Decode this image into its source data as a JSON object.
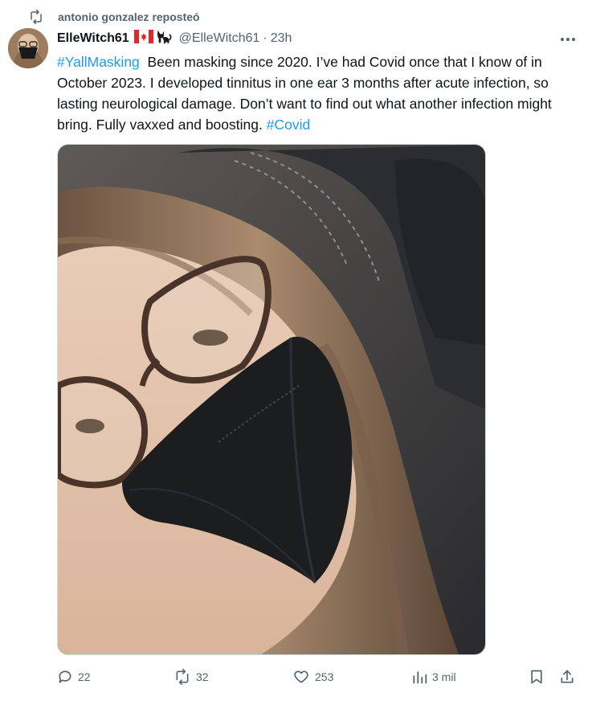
{
  "repost": {
    "icon": "repost-icon",
    "text": "antonio gonzalez reposteó"
  },
  "author": {
    "name": "ElleWitch61",
    "emoji": [
      "canada-flag-icon",
      "black-cat-icon"
    ],
    "handle": "@ElleWitch61",
    "separator": "·",
    "time": "23h"
  },
  "tweet": {
    "hashtag_1": "#YallMasking",
    "text_main": "Been masking since 2020. I’ve had Covid once that I know of in October 2023. I developed tinnitus in one ear 3 months after acute infection, so lasting neurological damage. Don’t want to find out what another infection might bring. Fully vaxxed and boosting.",
    "hashtag_2": "#Covid"
  },
  "actions": {
    "replies": "22",
    "reposts": "32",
    "likes": "253",
    "views": "3 mil"
  },
  "colors": {
    "accent": "#1d9bf0",
    "muted": "#536471",
    "text": "#0f1419"
  }
}
